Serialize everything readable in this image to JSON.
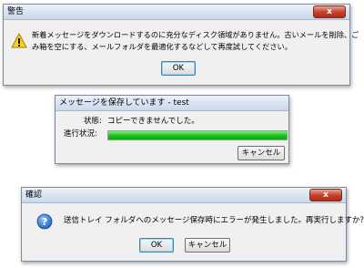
{
  "warning_dialog": {
    "title": "警告",
    "close_label": "x",
    "message_line1": "新着メッセージをダウンロードするのに充分なディスク領域がありません。古いメールを削除、ご",
    "message_line2": "み箱を空にする、メールフォルダを最適化するなどして再度試してください。",
    "ok_label": "OK",
    "icon": "warning-triangle-icon"
  },
  "save_dialog": {
    "title": "メッセージを保存しています - test",
    "status_label": "状態:",
    "status_value": "コピーできませんでした。",
    "progress_label": "進行状況:",
    "progress_fraction": 1.0,
    "cancel_label": "キャンセル"
  },
  "confirm_dialog": {
    "title": "確認",
    "close_label": "x",
    "message": "送信トレイ フォルダへのメッセージ保存時にエラーが発生しました。再実行しますか？",
    "ok_label": "OK",
    "cancel_label": "キャンセル",
    "icon": "question-icon"
  },
  "colors": {
    "progress_fill": "#1fc11f",
    "close_button": "#c4452d"
  }
}
